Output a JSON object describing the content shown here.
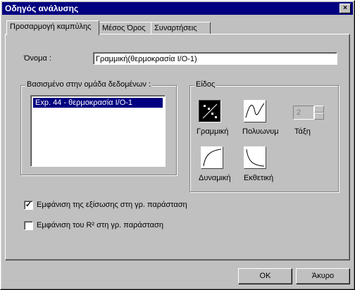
{
  "window": {
    "title": "Οδηγός ανάλυσης",
    "close_glyph": "×"
  },
  "tabs": [
    {
      "label": "Προσαρμογή καμπύλης"
    },
    {
      "label": "Μέσος Όρος"
    },
    {
      "label": "Συναρτήσεις"
    }
  ],
  "name_field": {
    "label": "Όνομα :",
    "value": "Γραμμική(θερμοκρασία I/O-1)"
  },
  "dataset_group": {
    "title": "Βασισμένο στην ομάδα δεδομένων :",
    "items": [
      "Exp. 44 - θερμοκρασία I/O-1"
    ]
  },
  "type_group": {
    "title": "Είδος",
    "types": [
      {
        "label": "Γραμμική",
        "icon": "linear-fit-icon"
      },
      {
        "label": "Πολυωνυμ",
        "icon": "polynomial-fit-icon"
      },
      {
        "label": "Δυναμική",
        "icon": "power-fit-icon"
      },
      {
        "label": "Εκθετική",
        "icon": "exponential-fit-icon"
      }
    ],
    "order_label": "Τάξη",
    "order_value": "2"
  },
  "options": {
    "show_equation": {
      "label": "Εμφάνιση της εξίσωσης στη γρ. παράσταση",
      "checked": true,
      "glyph": "✓"
    },
    "show_r2": {
      "label": "Εμφάνιση του R² στη γρ. παράσταση",
      "checked": false,
      "glyph": ""
    }
  },
  "buttons": {
    "ok": "OK",
    "cancel": "Άκυρο"
  }
}
